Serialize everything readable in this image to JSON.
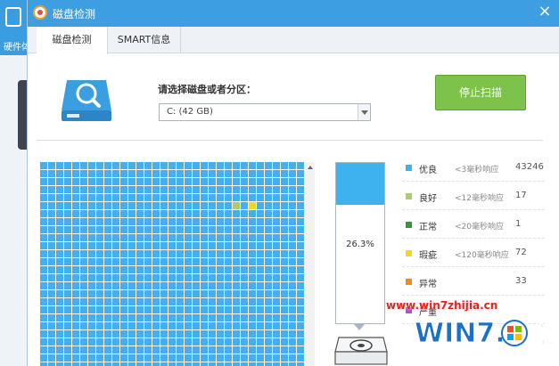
{
  "background_app": {
    "label": "硬件体"
  },
  "window": {
    "title": "磁盘检测"
  },
  "tabs": [
    {
      "label": "磁盘检测",
      "active": true
    },
    {
      "label": "SMART信息",
      "active": false
    }
  ],
  "select": {
    "label": "请选择磁盘或者分区：",
    "value": "C:  (42 GB)"
  },
  "stop_button": {
    "label": "停止扫描"
  },
  "grid": {
    "columns": 36,
    "rows": 26,
    "cell_colors": {
      "excellent": "#45aeed",
      "good": "#a9cf62",
      "abnormal": "#f0d820"
    },
    "good_cells": [
      {
        "row": 5,
        "col": 24
      }
    ],
    "abnormal_cells": [
      {
        "row": 5,
        "col": 26
      }
    ]
  },
  "progress": {
    "percent_text": "26.3%",
    "value": 0.263
  },
  "legend": [
    {
      "name": "优良",
      "desc": "<3毫秒响应",
      "count": "43246",
      "color": "#3eb1ef"
    },
    {
      "name": "良好",
      "desc": "<12毫秒响应",
      "count": "17",
      "color": "#a9cf62"
    },
    {
      "name": "正常",
      "desc": "<20毫秒响应",
      "count": "1",
      "color": "#2e9a3a"
    },
    {
      "name": "瑕疵",
      "desc": "<120毫秒响应",
      "count": "72",
      "color": "#f0d820"
    },
    {
      "name": "异常",
      "desc": "",
      "count": "33",
      "color": "#f08a20"
    },
    {
      "name": "严重",
      "desc": "",
      "count": "",
      "color": "#b04fd0"
    }
  ],
  "watermark": {
    "url": "www.win7zhijia.cn",
    "logo_text": "WIN7.",
    "logo_suffix": "家"
  }
}
